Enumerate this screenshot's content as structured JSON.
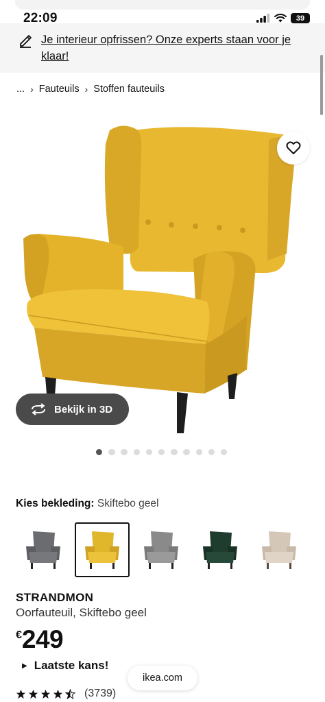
{
  "status_bar": {
    "time": "22:09",
    "battery": "39"
  },
  "promo": {
    "text": "Je interieur opfrissen? Onze experts staan voor je klaar!"
  },
  "breadcrumb": {
    "ellipsis": "...",
    "items": [
      "Fauteuils",
      "Stoffen fauteuils"
    ]
  },
  "gallery": {
    "view_3d_label": "Bekijk in 3D",
    "dot_count": 11,
    "active_index": 0
  },
  "upholstery": {
    "label": "Kies bekleding:",
    "selected": "Skiftebo geel",
    "swatches": [
      {
        "name": "grey",
        "color": "#6b6c70"
      },
      {
        "name": "yellow",
        "color": "#e0b62a"
      },
      {
        "name": "houndstooth",
        "color": "#8a8a8a"
      },
      {
        "name": "dark-green",
        "color": "#1f3d2f"
      },
      {
        "name": "beige",
        "color": "#d5c7b8"
      }
    ]
  },
  "product": {
    "name": "STRANDMON",
    "description": "Oorfauteuil, Skiftebo geel",
    "currency": "€",
    "price": "249",
    "last_chance": "Laatste kans!",
    "rating": 4.5,
    "review_count": "(3739)"
  },
  "browser": {
    "url": "ikea.com"
  },
  "colors": {
    "chair": "#e7b62a",
    "chair_shadow": "#c99a1f",
    "legs": "#1e1e1e",
    "button_dark": "#4a4a4a"
  }
}
